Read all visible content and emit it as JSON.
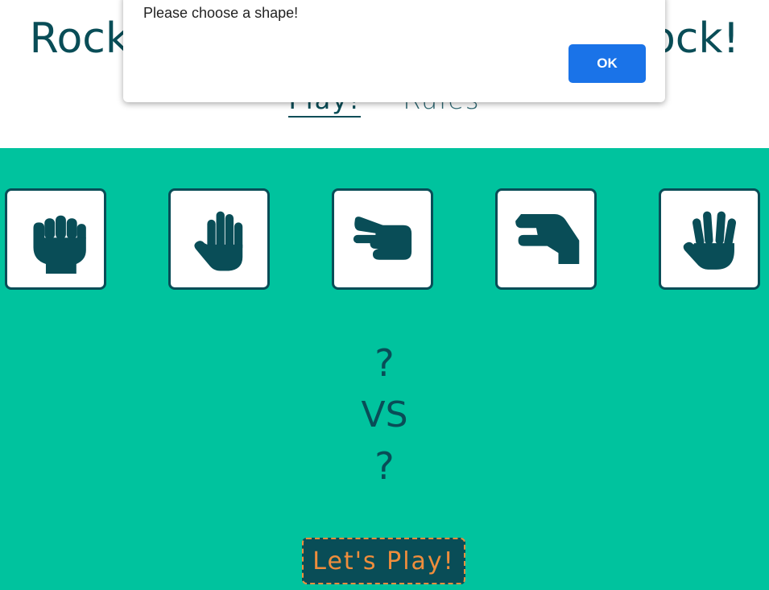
{
  "header": {
    "title": "Rock Paper Scissors Lizard Spock!",
    "nav": [
      {
        "label": "Play!",
        "active": true
      },
      {
        "label": "Rules",
        "active": false
      }
    ]
  },
  "choices": [
    {
      "name": "rock",
      "icon": "hand-rock-icon"
    },
    {
      "name": "paper",
      "icon": "hand-paper-icon"
    },
    {
      "name": "scissors",
      "icon": "hand-scissors-icon"
    },
    {
      "name": "lizard",
      "icon": "hand-lizard-icon"
    },
    {
      "name": "spock",
      "icon": "hand-spock-icon"
    }
  ],
  "result": {
    "player": "?",
    "vs": "VS",
    "computer": "?"
  },
  "play_button": "Let's Play!",
  "dialog": {
    "message": "Please choose a shape!",
    "ok_label": "OK"
  },
  "colors": {
    "primary": "#094d57",
    "game_bg": "#00c39e",
    "accent": "#ef8d3c",
    "dialog_button": "#1a73e8"
  }
}
